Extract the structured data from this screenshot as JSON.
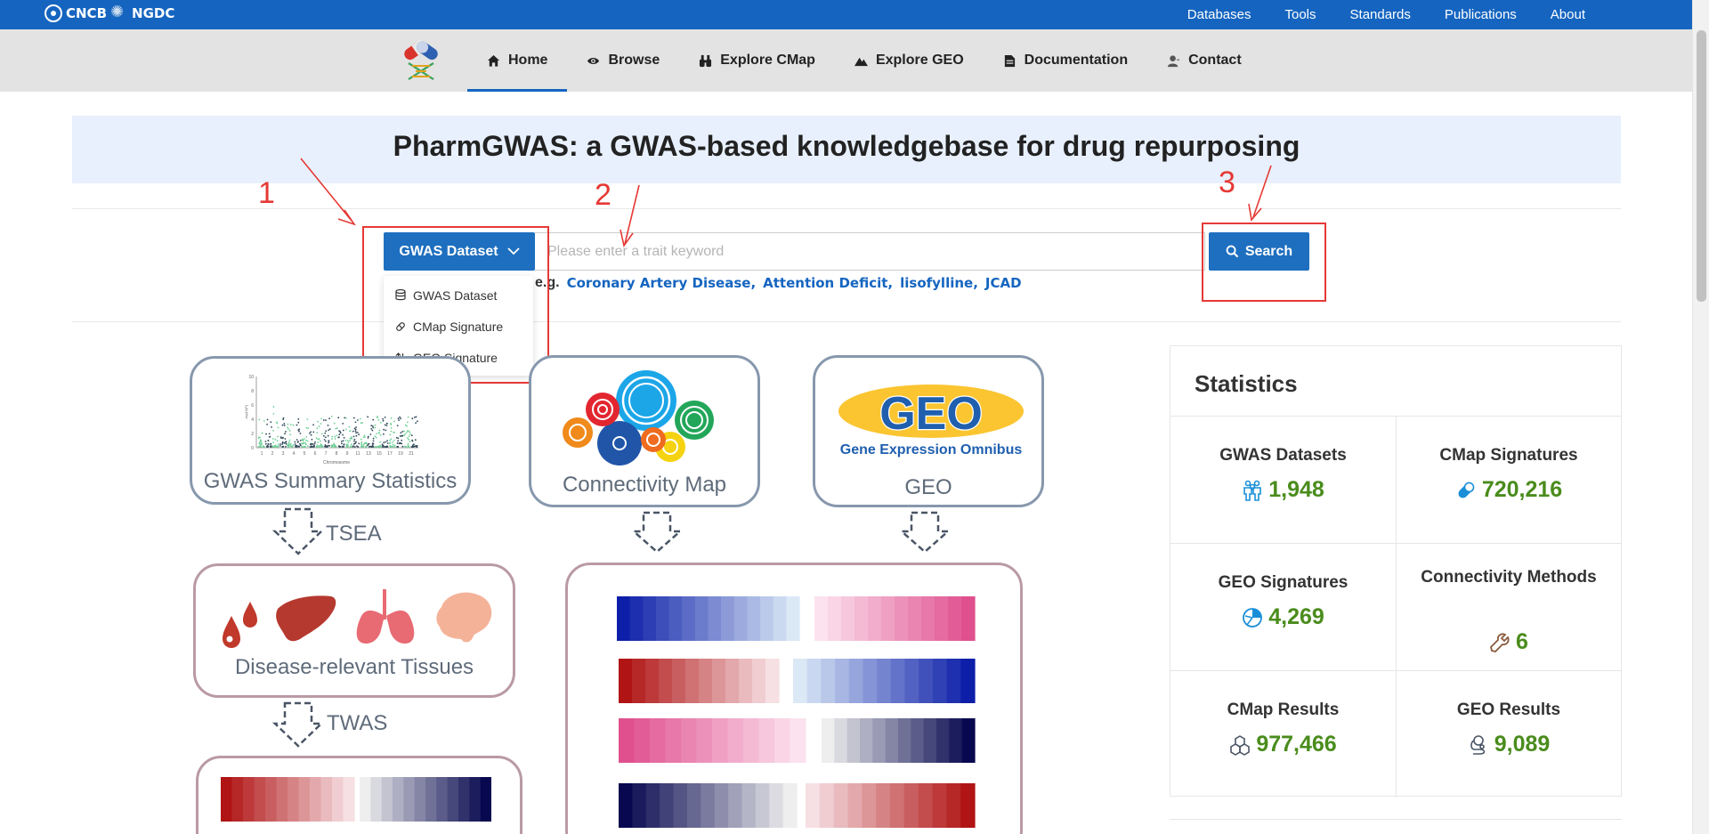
{
  "topbar": {
    "logo_text": "CNCB",
    "logo_text2": "NGDC",
    "links": [
      "Databases",
      "Tools",
      "Standards",
      "Publications",
      "About"
    ]
  },
  "nav": {
    "items": [
      {
        "label": "Home",
        "icon": "home-icon"
      },
      {
        "label": "Browse",
        "icon": "eye-icon"
      },
      {
        "label": "Explore CMap",
        "icon": "binoculars-icon"
      },
      {
        "label": "Explore GEO",
        "icon": "mountain-icon"
      },
      {
        "label": "Documentation",
        "icon": "document-icon"
      },
      {
        "label": "Contact",
        "icon": "user-icon"
      }
    ],
    "active": "Home"
  },
  "banner": {
    "title": "PharmGWAS: a GWAS-based knowledgebase for drug repurposing"
  },
  "search": {
    "dropdown_label": "GWAS Dataset",
    "dropdown_options": [
      "GWAS Dataset",
      "CMap Signature",
      "GEO Signature"
    ],
    "placeholder": "Please enter a trait keyword",
    "button_label": "Search",
    "examples_label": "e.g.",
    "examples": [
      "Coronary Artery Disease,",
      "Attention Deficit,",
      "lisofylline,",
      "JCAD"
    ]
  },
  "annotations": {
    "marker1": "1",
    "marker2": "2",
    "marker3": "3",
    "color": "#e53935"
  },
  "workflow": {
    "card_gwas": "GWAS Summary Statistics",
    "card_cmap": "Connectivity Map",
    "card_geo": "GEO",
    "geo_logo_text": "GEO",
    "geo_logo_sub": "Gene Expression Omnibus",
    "step_tsea": "TSEA",
    "step_twas": "TWAS",
    "card_tissues": "Disease-relevant Tissues",
    "manhattan_xlabel": "Chromosome",
    "manhattan_ylabel": "-log10(P)",
    "manhattan_yticks": [
      "10",
      "8",
      "6",
      "4",
      "2",
      "0"
    ],
    "manhattan_xticks": [
      "1",
      "2",
      "3",
      "4",
      "5",
      "6",
      "7",
      "8",
      "9",
      "11",
      "13",
      "15",
      "17",
      "19",
      "21"
    ]
  },
  "statistics": {
    "title": "Statistics",
    "items": [
      {
        "label": "GWAS Datasets",
        "value": "1,948",
        "icon": "people-icon"
      },
      {
        "label": "CMap Signatures",
        "value": "720,216",
        "icon": "pill-icon"
      },
      {
        "label": "GEO Signatures",
        "value": "4,269",
        "icon": "chart-pie-icon"
      },
      {
        "label": "Connectivity Methods",
        "value": "6",
        "icon": "wrench-icon"
      },
      {
        "label": "CMap Results",
        "value": "977,466",
        "icon": "cubes-icon"
      },
      {
        "label": "GEO Results",
        "value": "9,089",
        "icon": "results-icon"
      }
    ],
    "value_color": "#4a8c1c"
  },
  "colors": {
    "brand": "#1565c0",
    "button": "#1e6fbf",
    "nav_bg": "#e3e3e3",
    "banner_bg": "#e8f0fe"
  }
}
